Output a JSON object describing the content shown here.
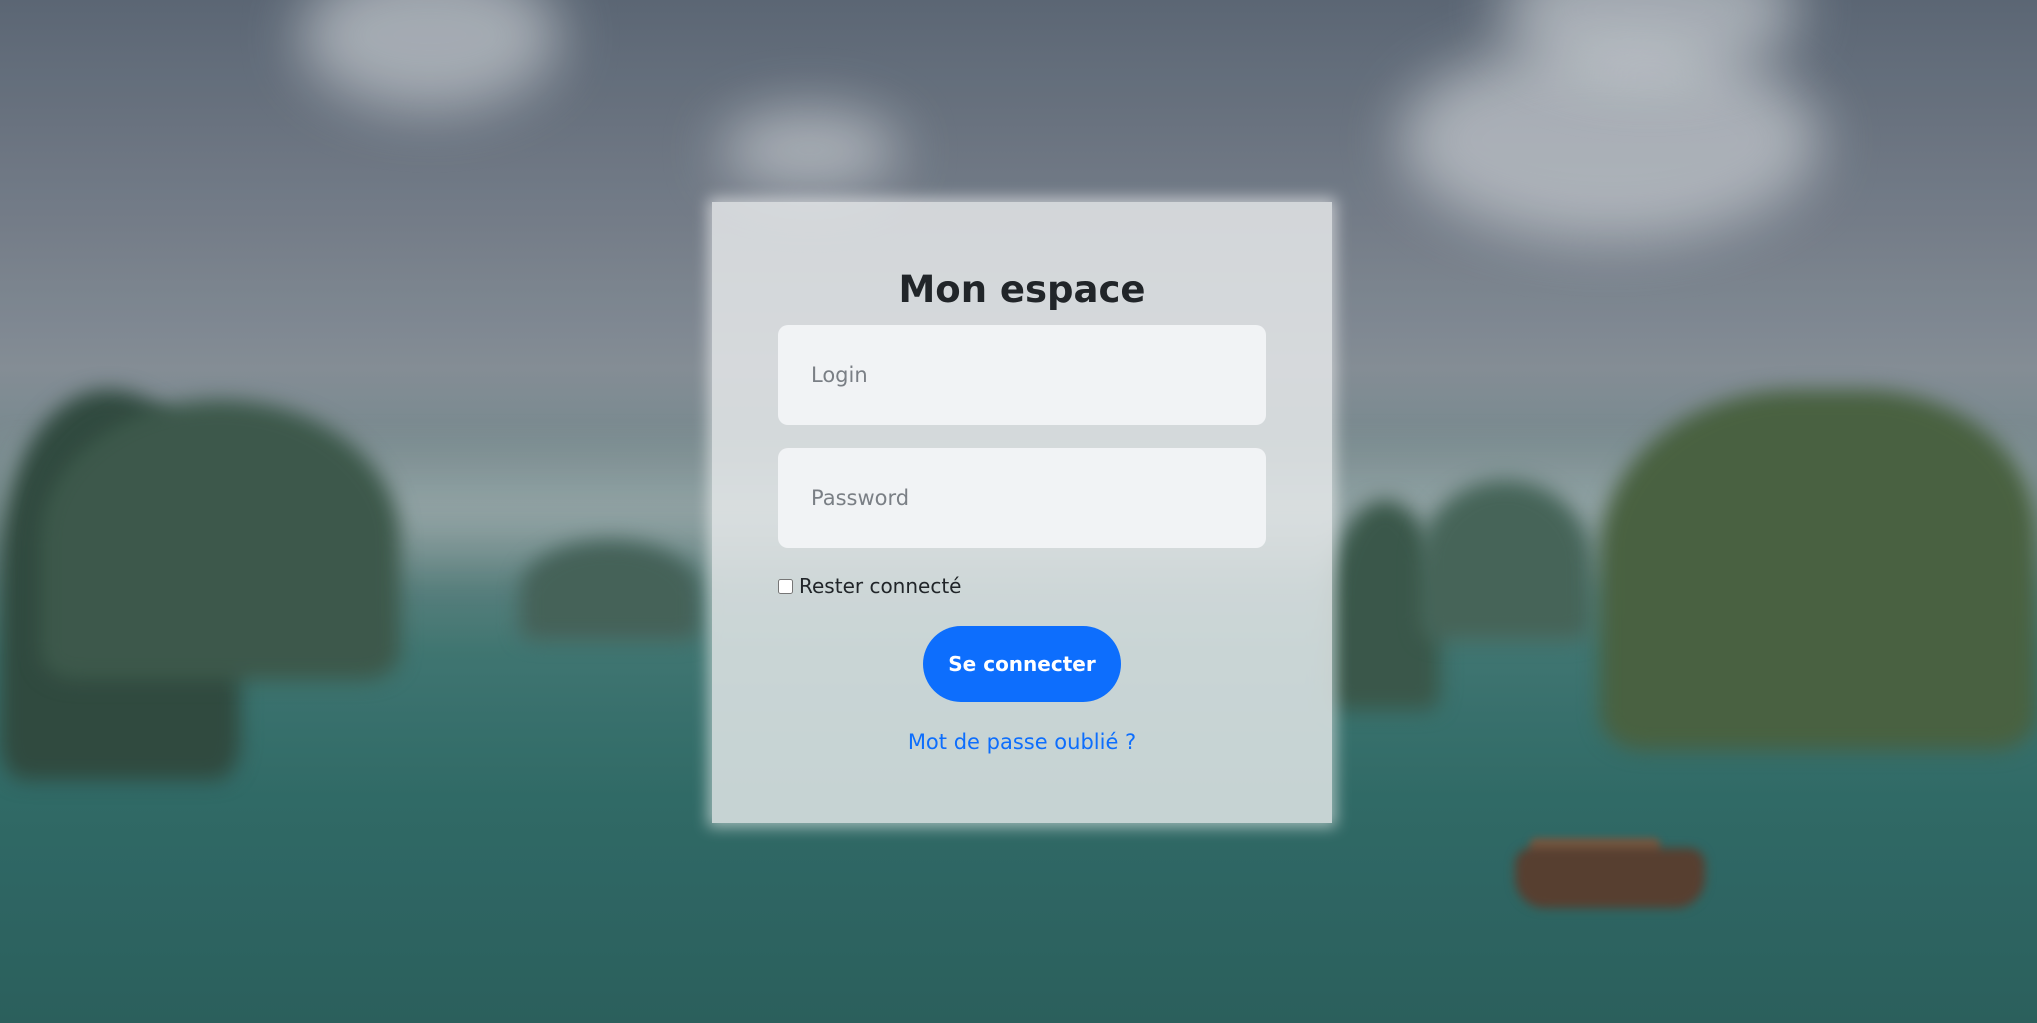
{
  "card": {
    "title": "Mon espace"
  },
  "form": {
    "login_placeholder": "Login",
    "password_placeholder": "Password",
    "remember_label": "Rester connecté",
    "remember_checked": false,
    "submit_label": "Se connecter",
    "forgot_link": "Mot de passe oublié ?"
  },
  "colors": {
    "primary": "#0d6efd",
    "title_text": "#212529",
    "field_bg": "#f1f3f5"
  }
}
